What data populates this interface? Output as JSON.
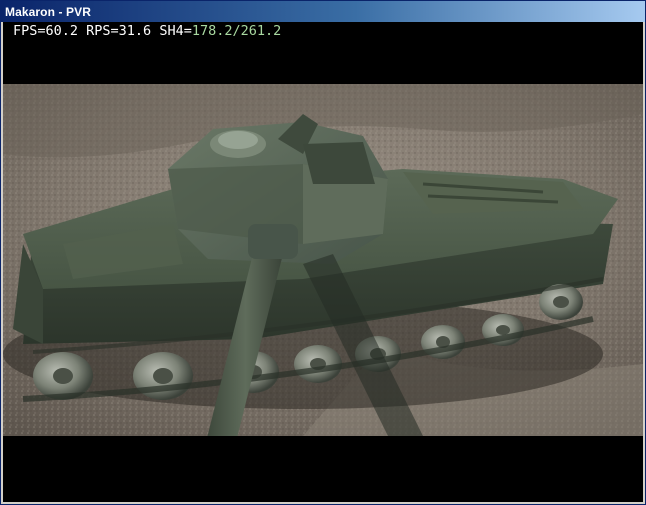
{
  "window": {
    "title": "Makaron - PVR"
  },
  "overlay": {
    "fps_label": "FPS=",
    "fps_value": "60.2",
    "rps_label": " RPS=",
    "rps_value": "31.6",
    "sh4_label": " SH4=",
    "sh4_value": "178.2/261.2"
  },
  "colors": {
    "titlebar_start": "#0a246a",
    "titlebar_end": "#a6caf0",
    "overlay_text": "#ffffff",
    "sh4_value": "#a8d8a0",
    "ground": "#857c72",
    "tank_body": "#4a5a48"
  },
  "scene": {
    "description_icon": "game-render-frame"
  }
}
